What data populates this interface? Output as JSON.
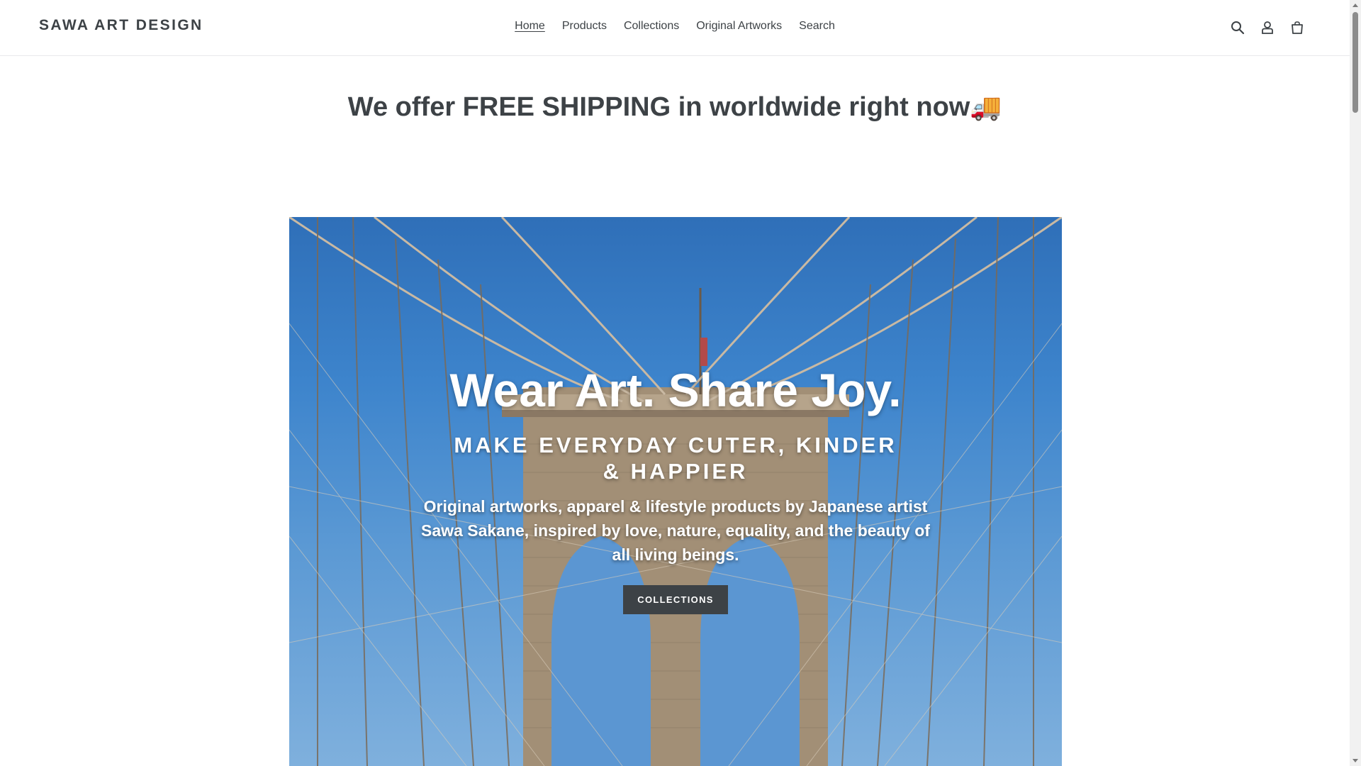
{
  "header": {
    "logo": "SAWA ART DESIGN",
    "nav": [
      {
        "label": "Home",
        "active": true
      },
      {
        "label": "Products",
        "active": false
      },
      {
        "label": "Collections",
        "active": false
      },
      {
        "label": "Original Artworks",
        "active": false
      },
      {
        "label": "Search",
        "active": false
      }
    ],
    "icons": [
      "search-icon",
      "account-icon",
      "cart-icon"
    ]
  },
  "promo": {
    "text": "We offer FREE SHIPPING in worldwide right now",
    "emoji": "🚚"
  },
  "hero": {
    "title": "Wear Art. Share Joy.",
    "subtitle": "MAKE EVERYDAY CUTER, KINDER & HAPPIER",
    "text": "Original artworks, apparel & lifestyle products by Japanese artist Sawa Sakane, inspired by love, nature, equality, and the beauty of all living beings.",
    "button_label": "COLLECTIONS"
  },
  "colors": {
    "text": "#3d4246",
    "button": "#3d4246",
    "sky": "#3d84cc"
  }
}
